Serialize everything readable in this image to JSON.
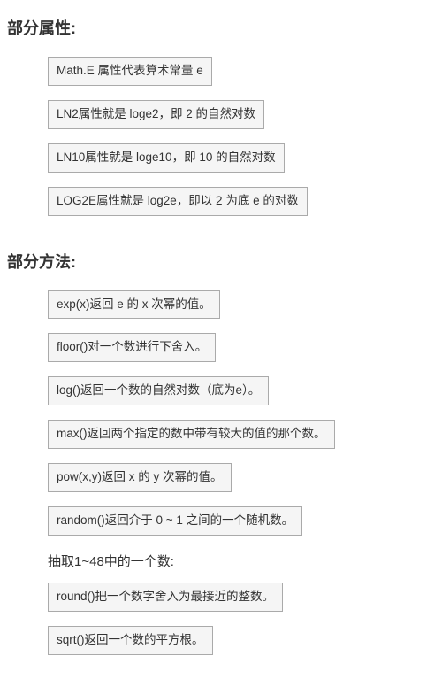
{
  "sections": [
    {
      "heading": "部分属性:",
      "items": [
        {
          "type": "boxed",
          "text": "Math.E 属性代表算术常量 e"
        },
        {
          "type": "boxed",
          "text": "LN2属性就是 loge2，即 2 的自然对数"
        },
        {
          "type": "boxed",
          "text": "LN10属性就是 loge10，即 10 的自然对数"
        },
        {
          "type": "boxed",
          "text": "LOG2E属性就是 log2e，即以 2 为底 e 的对数"
        }
      ]
    },
    {
      "heading": "部分方法:",
      "items": [
        {
          "type": "boxed",
          "text": "exp(x)返回 e 的 x 次幂的值。"
        },
        {
          "type": "boxed",
          "text": "floor()对一个数进行下舍入。"
        },
        {
          "type": "boxed",
          "text": "log()返回一个数的自然对数（底为e）。"
        },
        {
          "type": "boxed",
          "text": "max()返回两个指定的数中带有较大的值的那个数。"
        },
        {
          "type": "boxed",
          "text": "pow(x,y)返回 x 的 y 次幂的值。"
        },
        {
          "type": "boxed",
          "text": "random()返回介于 0 ~ 1 之间的一个随机数。"
        },
        {
          "type": "plain",
          "text": "抽取1~48中的一个数:"
        },
        {
          "type": "boxed",
          "text": "round()把一个数字舍入为最接近的整数。"
        },
        {
          "type": "boxed",
          "text": "sqrt()返回一个数的平方根。"
        }
      ]
    }
  ]
}
